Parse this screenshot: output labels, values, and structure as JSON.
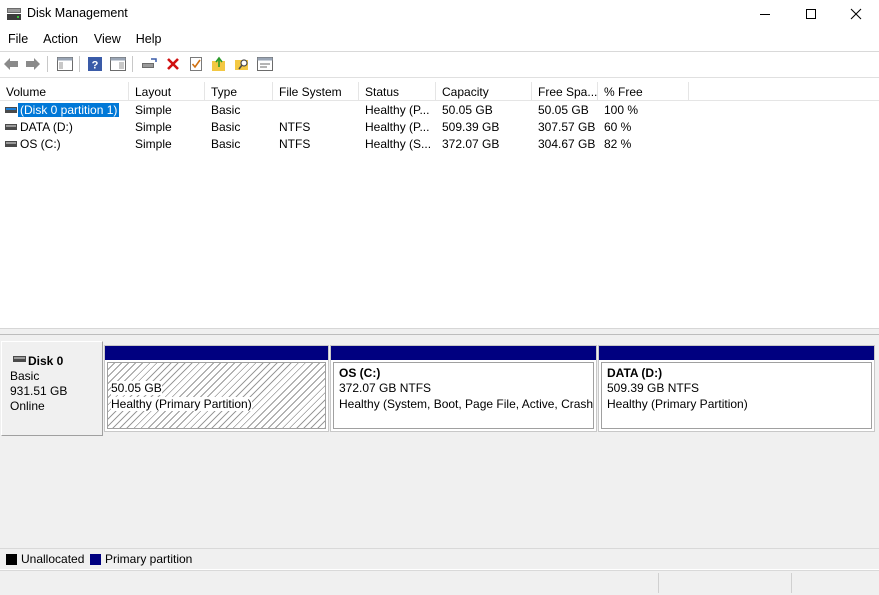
{
  "window": {
    "title": "Disk Management",
    "app_icon": "disk-management-icon",
    "controls": [
      "minimize-icon",
      "maximize-icon",
      "close-icon"
    ]
  },
  "menu": {
    "items": [
      {
        "label": "File"
      },
      {
        "label": "Action"
      },
      {
        "label": "View"
      },
      {
        "label": "Help"
      }
    ]
  },
  "toolbar": {
    "buttons": [
      "back-arrow-icon",
      "forward-arrow-icon",
      "show-hide-console-tree-icon",
      "help-icon",
      "properties-icon",
      "connect-drive-icon",
      "delete-icon",
      "check-icon",
      "open-folder-icon",
      "explore-icon",
      "console-icon"
    ]
  },
  "volume_table": {
    "columns": [
      "Volume",
      "Layout",
      "Type",
      "File System",
      "Status",
      "Capacity",
      "Free Spa...",
      "% Free"
    ],
    "rows": [
      {
        "volume": "(Disk 0 partition 1)",
        "layout": "Simple",
        "type": "Basic",
        "fs": "",
        "status": "Healthy (P...",
        "capacity": "50.05 GB",
        "free": "50.05 GB",
        "pct": "100 %",
        "selected": true
      },
      {
        "volume": "DATA (D:)",
        "layout": "Simple",
        "type": "Basic",
        "fs": "NTFS",
        "status": "Healthy (P...",
        "capacity": "509.39 GB",
        "free": "307.57 GB",
        "pct": "60 %",
        "selected": false
      },
      {
        "volume": "OS (C:)",
        "layout": "Simple",
        "type": "Basic",
        "fs": "NTFS",
        "status": "Healthy (S...",
        "capacity": "372.07 GB",
        "free": "304.67 GB",
        "pct": "82 %",
        "selected": false
      }
    ]
  },
  "disk": {
    "name": "Disk 0",
    "type": "Basic",
    "size": "931.51 GB",
    "state": "Online",
    "partitions": [
      {
        "title": "",
        "size_line": "50.05 GB",
        "status_line": "Healthy (Primary Partition)"
      },
      {
        "title": "OS  (C:)",
        "size_line": "372.07 GB NTFS",
        "status_line": "Healthy (System, Boot, Page File, Active, Crash Dump, Primary Partition)"
      },
      {
        "title": "DATA  (D:)",
        "size_line": "509.39 GB NTFS",
        "status_line": "Healthy (Primary Partition)"
      }
    ]
  },
  "legend": {
    "items": [
      {
        "label": "Unallocated",
        "color": "#000000"
      },
      {
        "label": "Primary partition",
        "color": "#000080"
      }
    ]
  },
  "colors": {
    "selection": "#0078d7",
    "partition_bar": "#000080",
    "panel_bg": "#f0f0f0"
  }
}
